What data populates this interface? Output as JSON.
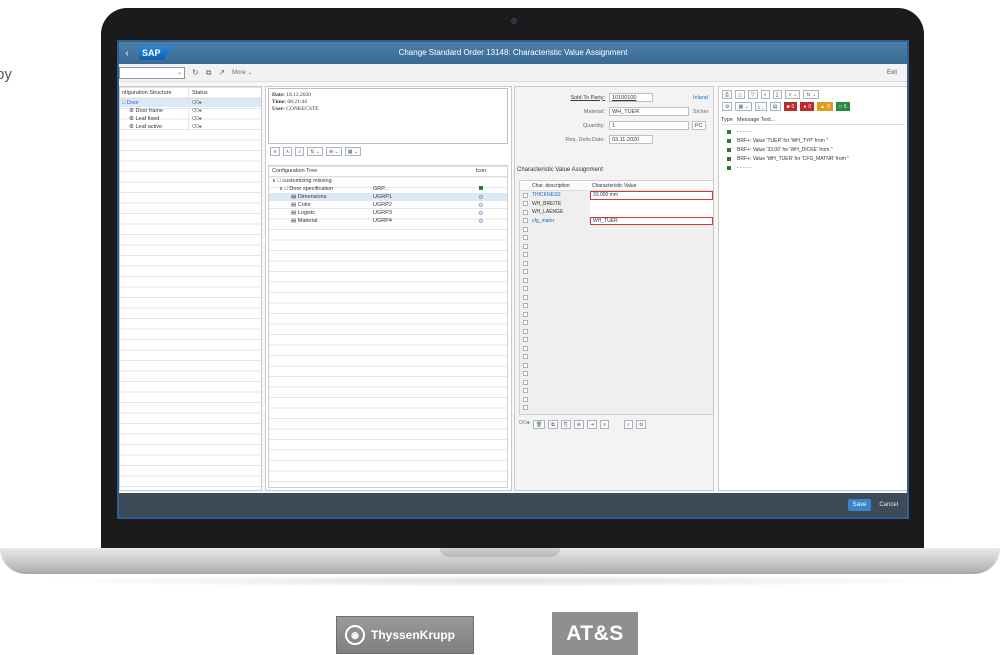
{
  "side_text": "by",
  "shell": {
    "back_icon": "back-icon",
    "logo": "SAP",
    "title": "Change Standard Order 13148: Characteristic Value Assignment"
  },
  "toolbar": {
    "more_label": "More",
    "exit_label": "Exit"
  },
  "structure_pane": {
    "headers": [
      "nfiguration Structure",
      "Status"
    ],
    "rows": [
      {
        "label": "Door",
        "status": "OO",
        "status_green": "●"
      },
      {
        "label": "Door frame",
        "status": "OO",
        "status_green": "●"
      },
      {
        "label": "Leaf fixed",
        "status": "OO",
        "status_green": "●"
      },
      {
        "label": "Leaf active",
        "status": "OO",
        "status_green": "●"
      }
    ]
  },
  "info": {
    "date_label": "Date:",
    "date": "18.12.2020",
    "time_label": "Time:",
    "time": "08:21:44",
    "user_label": "User:",
    "user": "CONKECSTE"
  },
  "config_tree": {
    "headers": {
      "tree": "Configuration Tree",
      "icon": "Icon"
    },
    "rows": [
      {
        "label": "customizing missing",
        "code": ""
      },
      {
        "label": "Door specification",
        "code": "GRP..."
      },
      {
        "label": "Dimensions",
        "code": "UGRP1"
      },
      {
        "label": "Color",
        "code": "UGRP2"
      },
      {
        "label": "Logistc",
        "code": "UGRP3"
      },
      {
        "label": "Material",
        "code": "UGRP4"
      }
    ]
  },
  "order": {
    "sold_to_label": "Sold-To Party:",
    "sold_to_value": "10100100",
    "sold_to_extra": "Inland",
    "material_label": "Material:",
    "material_value": "WH_TUER",
    "material_extra": "Sicher",
    "quantity_label": "Quantity:",
    "quantity_value": "1",
    "quantity_unit": "PC",
    "delivery_label": "Req. Deliv.Date:",
    "delivery_value": "03.11.2020"
  },
  "cva": {
    "title": "Characteristic Value Assignment",
    "col_desc": "Char. description",
    "col_value": "Characteristic Value",
    "rows": [
      {
        "desc": "THICKNESS",
        "value": "33.000 mm"
      },
      {
        "desc": "WH_BREITE",
        "value": ""
      },
      {
        "desc": "WH_LAENGE",
        "value": ""
      },
      {
        "desc": "cfg_matnr",
        "value": "WH_TUER"
      }
    ]
  },
  "messages": {
    "col_type": "Type",
    "col_text": "Message Text...",
    "counts": {
      "error": "0",
      "error2": "0",
      "warning": "0",
      "info": "5"
    },
    "rows": [
      "- - - - -",
      "BRF+: Value 'TUER' for 'WH_TYP' from ''",
      "BRF+: Value '33.00' for 'WH_DICKE' from ''",
      "BRF+: Value 'WH_TUER' for 'CFG_MATNR' from ''",
      "- - - - -"
    ]
  },
  "footer": {
    "save": "Save",
    "cancel": "Cancel"
  },
  "logos": {
    "thyssenkrupp": "ThyssenKrupp",
    "ats": "AT&S"
  },
  "colors": {
    "shell": "#3a6b96",
    "footer": "#3d4a57",
    "accent": "#0a6ed1",
    "error": "#d0383e",
    "success": "#2b7d2b"
  }
}
